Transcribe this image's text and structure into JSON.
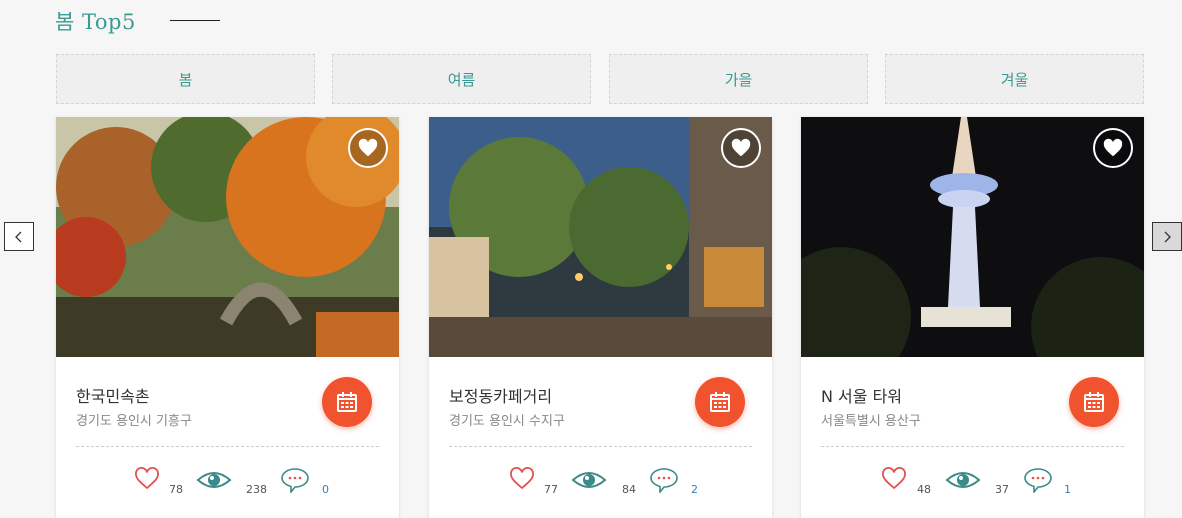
{
  "section": {
    "title": "봄 Top5"
  },
  "tabs": [
    "봄",
    "여름",
    "가을",
    "겨울"
  ],
  "cards": [
    {
      "name": "한국민속촌",
      "location": "경기도 용인시 기흥구",
      "likes": "78",
      "views": "238",
      "comments": "0"
    },
    {
      "name": "보정동카페거리",
      "location": "경기도 용인시 수지구",
      "likes": "77",
      "views": "84",
      "comments": "2"
    },
    {
      "name": "N 서울 타워",
      "location": "서울특별시 용산구",
      "likes": "48",
      "views": "37",
      "comments": "1"
    }
  ],
  "colors": {
    "accent": "#3a9a94",
    "calendar_button": "#f0532d",
    "heart": "#e0534f"
  },
  "icons": {
    "like": "heart-outline-icon",
    "favorite": "heart-icon",
    "views": "eye-icon",
    "comments": "speech-bubble-icon",
    "schedule": "calendar-icon",
    "prev": "chevron-left-icon",
    "next": "chevron-right-icon"
  }
}
